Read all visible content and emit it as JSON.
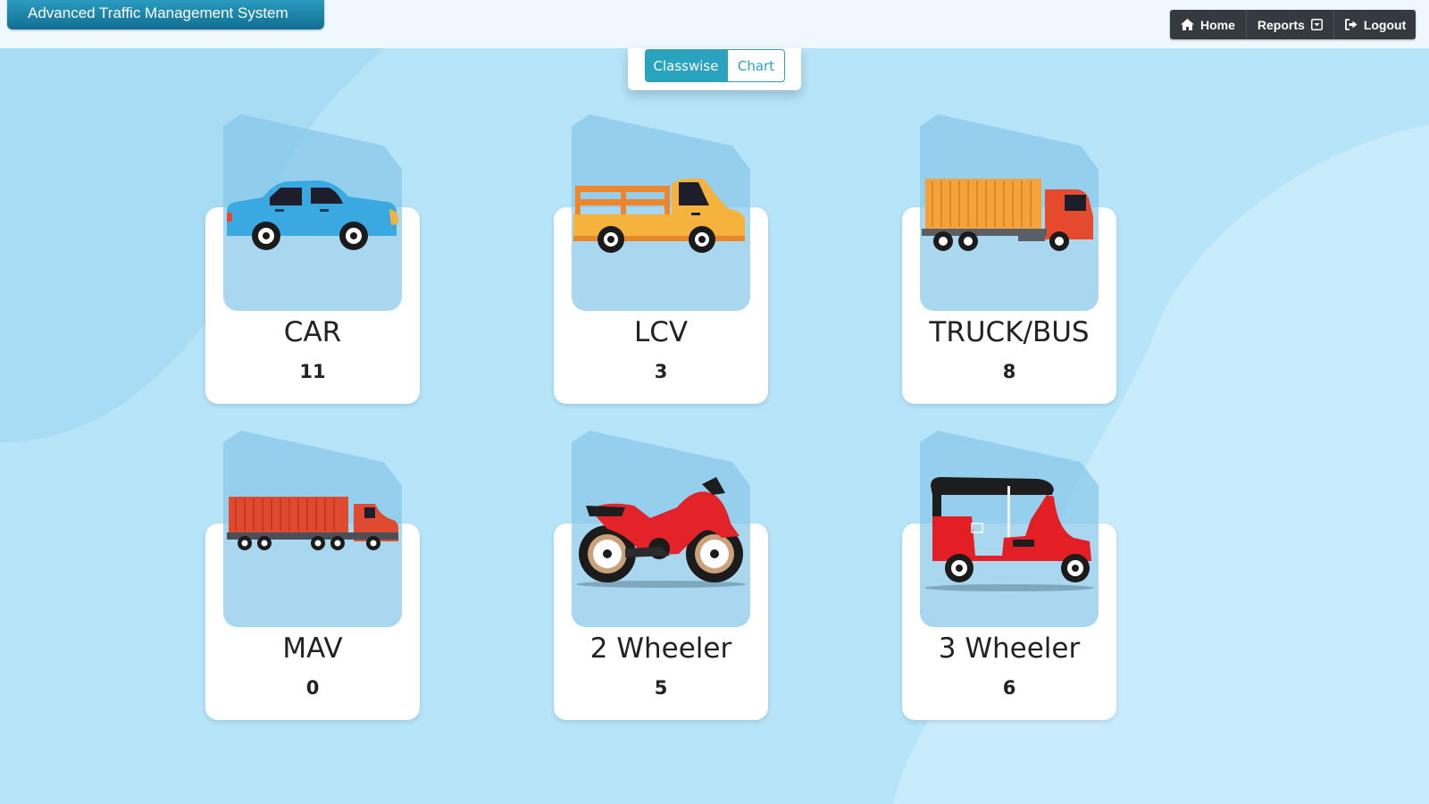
{
  "app": {
    "title": "Advanced Traffic Management System"
  },
  "nav": {
    "home_label": "Home",
    "reports_label": "Reports",
    "logout_label": "Logout"
  },
  "toggle": {
    "classwise_label": "Classwise",
    "chart_label": "Chart",
    "active": "Classwise"
  },
  "colors": {
    "page_background": "#b6e4f9",
    "brand_gradient_top": "#2a9bc0",
    "brand_gradient_bottom": "#126e93",
    "nav_background": "#343a40",
    "accent": "#2aa3bf"
  },
  "vehicles": [
    {
      "name": "CAR",
      "count": "11",
      "icon": "car-icon"
    },
    {
      "name": "LCV",
      "count": "3",
      "icon": "pickup-truck-icon"
    },
    {
      "name": "TRUCK/BUS",
      "count": "8",
      "icon": "cargo-truck-icon"
    },
    {
      "name": "MAV",
      "count": "0",
      "icon": "trailer-truck-icon"
    },
    {
      "name": "2 Wheeler",
      "count": "5",
      "icon": "motorcycle-icon"
    },
    {
      "name": "3 Wheeler",
      "count": "6",
      "icon": "auto-rickshaw-icon"
    }
  ]
}
